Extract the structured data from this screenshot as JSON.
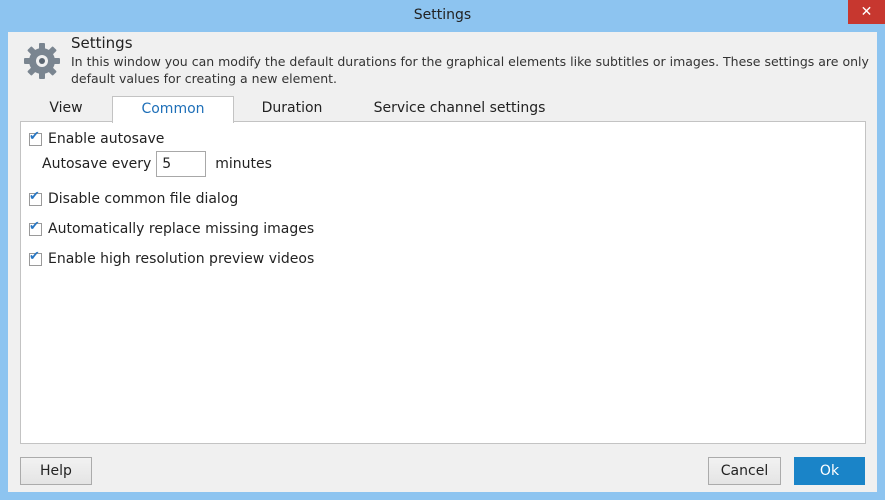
{
  "window": {
    "title": "Settings"
  },
  "header": {
    "title": "Settings",
    "description": "In this window you can modify the default durations for the graphical elements like subtitles or images. These settings are only default values for creating a new element."
  },
  "tabs": [
    {
      "label": "View",
      "active": false
    },
    {
      "label": "Common",
      "active": true
    },
    {
      "label": "Duration",
      "active": false
    },
    {
      "label": "Service channel settings",
      "active": false
    }
  ],
  "common": {
    "enable_autosave": {
      "label": "Enable autosave",
      "checked": true
    },
    "autosave": {
      "prefix": "Autosave every",
      "value": "5",
      "suffix": "minutes"
    },
    "disable_file_dialog": {
      "label": "Disable common file dialog",
      "checked": true
    },
    "replace_missing": {
      "label": "Automatically replace missing images",
      "checked": true
    },
    "high_res_preview": {
      "label": "Enable high resolution preview videos",
      "checked": true
    }
  },
  "buttons": {
    "help": "Help",
    "cancel": "Cancel",
    "ok": "Ok"
  },
  "icons": {
    "close": "close-icon",
    "settings": "gear-icon",
    "check": "checkmark-icon"
  },
  "colors": {
    "titlebar": "#8dc4f0",
    "close": "#c7372f",
    "accent": "#1a84c8",
    "active_tab_text": "#1e6fb8"
  }
}
